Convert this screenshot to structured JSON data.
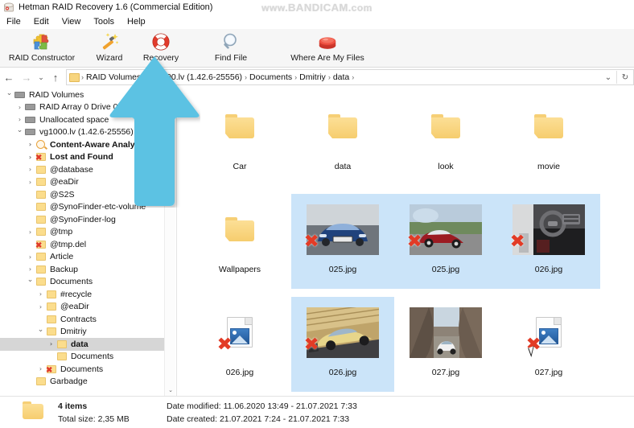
{
  "window": {
    "title": "Hetman RAID Recovery 1.6 (Commercial Edition)",
    "icon": "app-icon"
  },
  "watermark": {
    "prefix": "www.",
    "brand": "BANDICAM",
    "suffix": ".com"
  },
  "menu": {
    "items": [
      "File",
      "Edit",
      "View",
      "Tools",
      "Help"
    ]
  },
  "toolbar": {
    "buttons": [
      {
        "label": "RAID Constructor",
        "icon": "puzzle-icon"
      },
      {
        "label": "Wizard",
        "icon": "magic-wand-icon"
      },
      {
        "label": "Recovery",
        "icon": "life-ring-icon"
      },
      {
        "label": "Find File",
        "icon": "magnifier-icon"
      },
      {
        "label": "Where Are My Files",
        "icon": "red-button-icon"
      }
    ]
  },
  "addressbar": {
    "back": "←",
    "forward": "→",
    "history": "⌄",
    "up": "↑",
    "crumbs": [
      "RAID Volumes",
      "vg1000.lv (1.42.6-25556)",
      "Documents",
      "Dmitriy",
      "data"
    ],
    "separator": "›",
    "dropdown": "⌄",
    "refresh": "↻"
  },
  "tree": {
    "nodes": [
      {
        "label": "RAID Volumes",
        "indent": 0,
        "chev": "down",
        "icon": "drive-icon",
        "bold": false,
        "selected": false
      },
      {
        "label": "RAID Array 0 Drive 0",
        "indent": 1,
        "chev": "right",
        "icon": "drive-icon",
        "bold": false,
        "selected": false
      },
      {
        "label": "Unallocated space",
        "indent": 1,
        "chev": "right",
        "icon": "drive-icon",
        "bold": false,
        "selected": false
      },
      {
        "label": "vg1000.lv (1.42.6-25556)",
        "indent": 1,
        "chev": "down",
        "icon": "drive-icon",
        "bold": false,
        "selected": false
      },
      {
        "label": "Content-Aware Analysis",
        "indent": 2,
        "chev": "right",
        "icon": "magnifier-icon",
        "bold": true,
        "selected": false
      },
      {
        "label": "Lost and Found",
        "indent": 2,
        "chev": "right",
        "icon": "folder-deleted-icon",
        "bold": true,
        "selected": false
      },
      {
        "label": "@database",
        "indent": 2,
        "chev": "right",
        "icon": "folder-icon",
        "bold": false,
        "selected": false
      },
      {
        "label": "@eaDir",
        "indent": 2,
        "chev": "right",
        "icon": "folder-icon",
        "bold": false,
        "selected": false
      },
      {
        "label": "@S2S",
        "indent": 2,
        "chev": "none",
        "icon": "folder-icon",
        "bold": false,
        "selected": false
      },
      {
        "label": "@SynoFinder-etc-volume",
        "indent": 2,
        "chev": "none",
        "icon": "folder-icon",
        "bold": false,
        "selected": false
      },
      {
        "label": "@SynoFinder-log",
        "indent": 2,
        "chev": "none",
        "icon": "folder-icon",
        "bold": false,
        "selected": false
      },
      {
        "label": "@tmp",
        "indent": 2,
        "chev": "right",
        "icon": "folder-icon",
        "bold": false,
        "selected": false
      },
      {
        "label": "@tmp.del",
        "indent": 2,
        "chev": "none",
        "icon": "folder-deleted-icon",
        "bold": false,
        "selected": false
      },
      {
        "label": "Article",
        "indent": 2,
        "chev": "right",
        "icon": "folder-icon",
        "bold": false,
        "selected": false
      },
      {
        "label": "Backup",
        "indent": 2,
        "chev": "right",
        "icon": "folder-icon",
        "bold": false,
        "selected": false
      },
      {
        "label": "Documents",
        "indent": 2,
        "chev": "down",
        "icon": "folder-icon",
        "bold": false,
        "selected": false
      },
      {
        "label": "#recycle",
        "indent": 3,
        "chev": "right",
        "icon": "folder-icon",
        "bold": false,
        "selected": false
      },
      {
        "label": "@eaDir",
        "indent": 3,
        "chev": "right",
        "icon": "folder-icon",
        "bold": false,
        "selected": false
      },
      {
        "label": "Contracts",
        "indent": 3,
        "chev": "none",
        "icon": "folder-icon",
        "bold": false,
        "selected": false
      },
      {
        "label": "Dmitriy",
        "indent": 3,
        "chev": "down",
        "icon": "folder-icon",
        "bold": false,
        "selected": false
      },
      {
        "label": "data",
        "indent": 4,
        "chev": "right",
        "icon": "folder-icon",
        "bold": true,
        "selected": true
      },
      {
        "label": "Documents",
        "indent": 4,
        "chev": "none",
        "icon": "folder-icon",
        "bold": false,
        "selected": false
      },
      {
        "label": "Documents",
        "indent": 3,
        "chev": "right",
        "icon": "folder-deleted-icon",
        "bold": false,
        "selected": false
      },
      {
        "label": "Garbadge",
        "indent": 2,
        "chev": "none",
        "icon": "folder-icon",
        "bold": false,
        "selected": false
      }
    ],
    "scrollbar": {
      "up": "⌃",
      "down": "⌄"
    }
  },
  "files": {
    "items": [
      {
        "label": "Car",
        "type": "folder",
        "selected": false,
        "deleted": false
      },
      {
        "label": "data",
        "type": "folder",
        "selected": false,
        "deleted": false
      },
      {
        "label": "look",
        "type": "folder",
        "selected": false,
        "deleted": false
      },
      {
        "label": "movie",
        "type": "folder",
        "selected": false,
        "deleted": false
      },
      {
        "label": "Wallpapers",
        "type": "folder",
        "selected": false,
        "deleted": false
      },
      {
        "label": "025.jpg",
        "type": "photo-blue-car",
        "selected": true,
        "deleted": true
      },
      {
        "label": "025.jpg",
        "type": "photo-red-car",
        "selected": true,
        "deleted": true
      },
      {
        "label": "026.jpg",
        "type": "photo-interior",
        "selected": true,
        "deleted": true
      },
      {
        "label": "026.jpg",
        "type": "image-file",
        "selected": false,
        "deleted": true
      },
      {
        "label": "026.jpg",
        "type": "photo-yellow-car",
        "selected": true,
        "deleted": true
      },
      {
        "label": "027.jpg",
        "type": "photo-canyon-suv",
        "selected": false,
        "deleted": false
      },
      {
        "label": "027.jpg",
        "type": "image-file",
        "selected": false,
        "deleted": true
      }
    ]
  },
  "statusbar": {
    "items_count": "4 items",
    "total_size": "Total size: 2,35 MB",
    "date_modified_label": "Date modified:",
    "date_modified_value": "11.06.2020 13:49 - 21.07.2021 7:33",
    "date_created_label": "Date created:",
    "date_created_value": "21.07.2021 7:24 - 21.07.2021 7:33"
  },
  "annotation": {
    "arrow_color": "#5cc2e3",
    "points_to": "Recovery"
  }
}
